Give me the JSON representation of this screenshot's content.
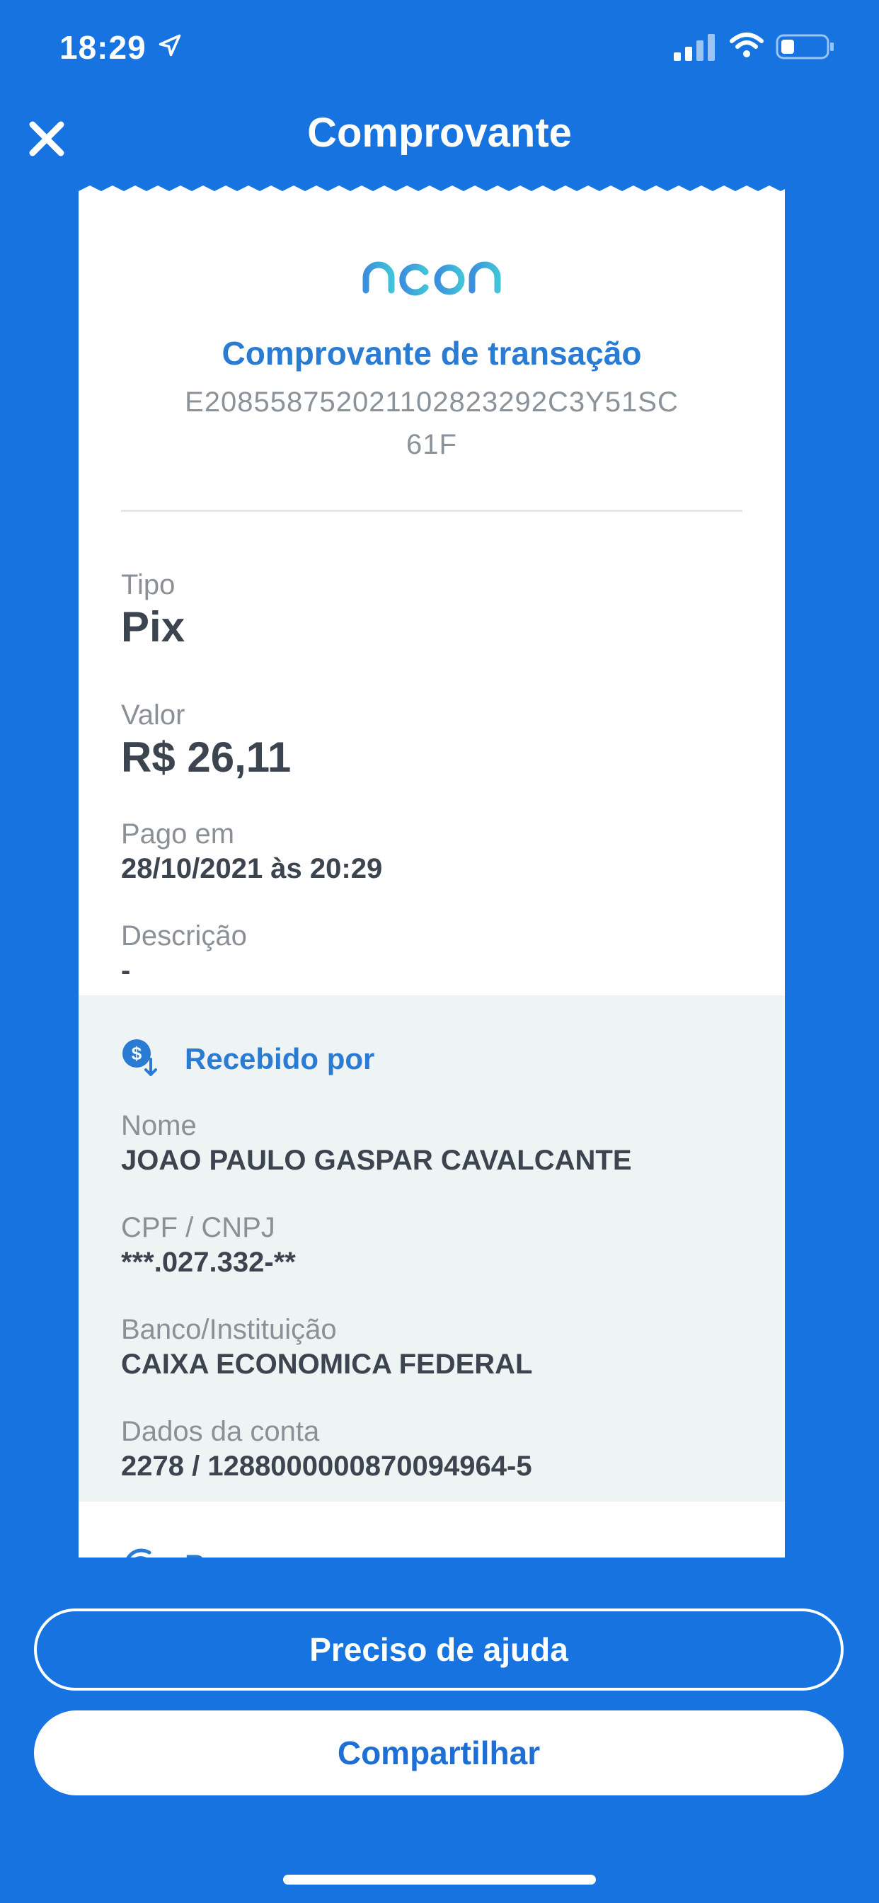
{
  "status_bar": {
    "time": "18:29"
  },
  "header": {
    "title": "Comprovante"
  },
  "receipt": {
    "logo_text": "neon",
    "heading": "Comprovante de transação",
    "transaction_id_line1": "E20855875202110282329​2C3Y51SC",
    "transaction_id_line2": "61F",
    "fields": {
      "tipo": {
        "label": "Tipo",
        "value": "Pix"
      },
      "valor": {
        "label": "Valor",
        "value": "R$ 26,11"
      },
      "pago_em": {
        "label": "Pago em",
        "value": "28/10/2021 às 20:29"
      },
      "descricao": {
        "label": "Descrição",
        "value": "-"
      }
    },
    "recebido_por": {
      "title": "Recebido por",
      "nome": {
        "label": "Nome",
        "value": "JOAO PAULO GASPAR CAVALCANTE"
      },
      "cpf": {
        "label": "CPF / CNPJ",
        "value": "***.027.332-**"
      },
      "banco": {
        "label": "Banco/Instituição",
        "value": "CAIXA ECONOMICA FEDERAL"
      },
      "conta": {
        "label": "Dados da conta",
        "value": "2278 / 1288000000870094964-5"
      }
    },
    "pago_por": {
      "title": "Pago por"
    }
  },
  "buttons": {
    "help": "Preciso de ajuda",
    "share": "Compartilhar"
  },
  "colors": {
    "background": "#1673e0",
    "accent": "#2a7bd4",
    "section_bg": "#eef3f3"
  }
}
